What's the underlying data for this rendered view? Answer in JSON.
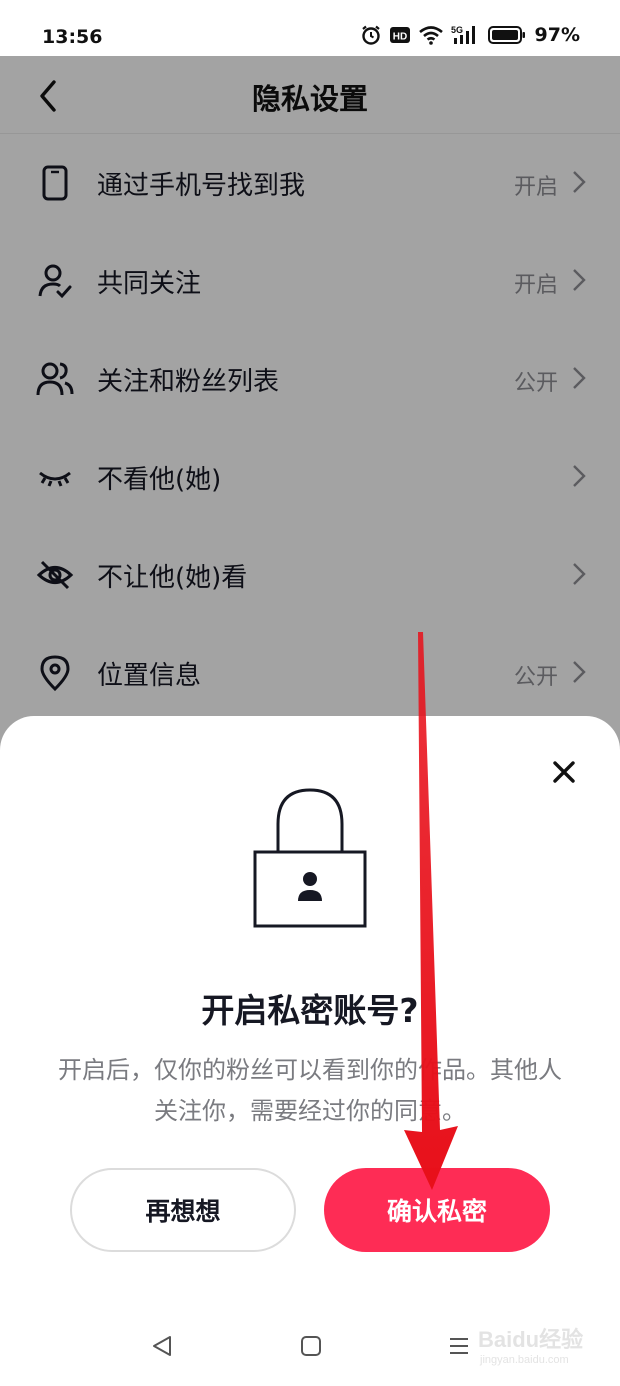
{
  "status_bar": {
    "time": "13:56",
    "network": "5G",
    "hd_badge": "HD",
    "battery": "97%",
    "icons": [
      "alarm-icon",
      "hd-icon",
      "wifi-icon",
      "signal-5g-icon",
      "battery-icon"
    ]
  },
  "header": {
    "title": "隐私设置",
    "back_icon": "chevron-left-icon"
  },
  "settings": {
    "items": [
      {
        "label": "通过手机号找到我",
        "value": "开启",
        "icon": "phone-icon"
      },
      {
        "label": "共同关注",
        "value": "开启",
        "icon": "user-check-icon"
      },
      {
        "label": "关注和粉丝列表",
        "value": "公开",
        "icon": "users-icon"
      },
      {
        "label": "不看他(她)",
        "value": "",
        "icon": "closed-eye-icon"
      },
      {
        "label": "不让他(她)看",
        "value": "",
        "icon": "eye-off-icon"
      },
      {
        "label": "位置信息",
        "value": "公开",
        "icon": "location-pin-icon"
      }
    ]
  },
  "dialog": {
    "title": "开启私密账号?",
    "description": "开启后，仅你的粉丝可以看到你的作品。其他人关注你，需要经过你的同意。",
    "cancel_label": "再想想",
    "confirm_label": "确认私密",
    "illustration": "lock-icon",
    "close_icon": "close-icon"
  },
  "colors": {
    "accent": "#fe2c55",
    "annotation_arrow": "#e8101a",
    "overlay": "rgba(0,0,0,0.34)"
  },
  "system_nav": {
    "icons": [
      "nav-back-icon",
      "nav-home-icon",
      "nav-menu-icon"
    ]
  },
  "watermark": {
    "brand": "Baidu经验",
    "url": "jingyan.baidu.com"
  }
}
